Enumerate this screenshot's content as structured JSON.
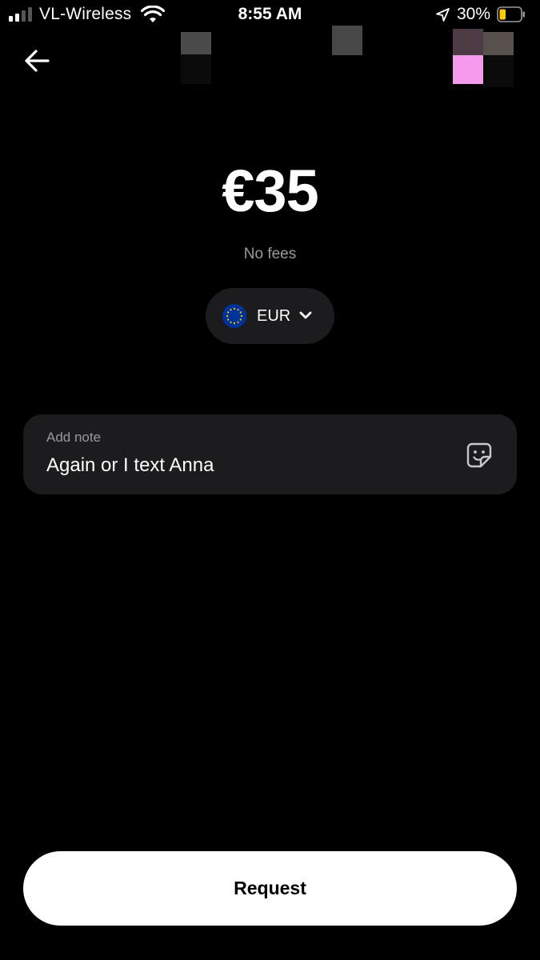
{
  "status_bar": {
    "carrier": "VL-Wireless",
    "time": "8:55 AM",
    "battery_percent": "30%",
    "battery_level": 0.3,
    "signal_bars_active": 2,
    "signal_bars_total": 4,
    "icons": [
      "signal-bars-icon",
      "wifi-icon",
      "location-arrow-icon",
      "battery-icon"
    ]
  },
  "nav": {
    "back_icon": "arrow-left-icon"
  },
  "amount": {
    "display": "€35",
    "fees_text": "No fees"
  },
  "currency": {
    "code": "EUR",
    "flag_icon": "eu-flag-icon",
    "dropdown_icon": "chevron-down-icon"
  },
  "note": {
    "label": "Add note",
    "value": "Again or I text Anna",
    "sticker_icon": "sticker-icon"
  },
  "actions": {
    "request_label": "Request"
  },
  "colors": {
    "background": "#000000",
    "surface": "#1c1c1e",
    "secondary_text": "#9a9a9e",
    "primary_button": "#ffffff",
    "eu_blue": "#003399",
    "eu_gold": "#ffcc00",
    "battery_low": "#ffcc00"
  }
}
